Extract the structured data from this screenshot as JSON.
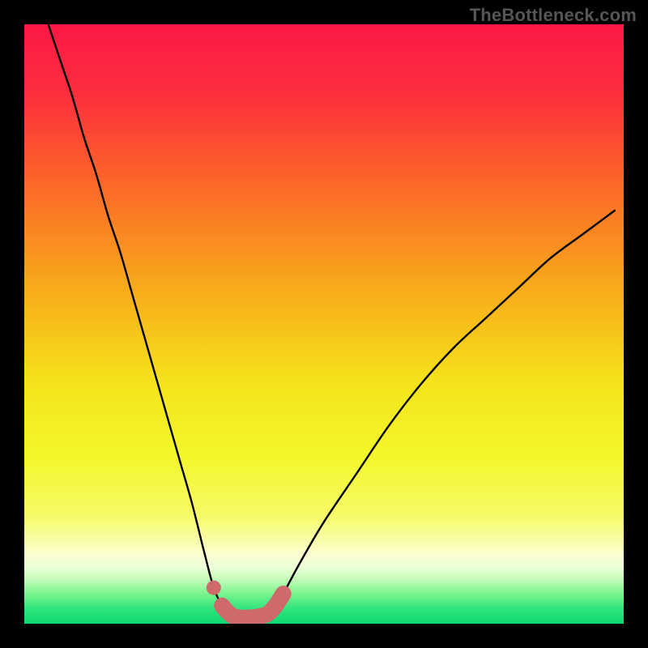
{
  "watermark": "TheBottleneck.com",
  "chart_data": {
    "type": "line",
    "title": "",
    "xlabel": "",
    "ylabel": "",
    "xlim": [
      0,
      100
    ],
    "ylim": [
      0,
      100
    ],
    "grid": false,
    "legend_position": "none",
    "series": [
      {
        "name": "bottleneck-curve",
        "x": [
          4,
          6,
          8,
          10,
          12,
          14,
          16,
          18,
          20,
          22,
          24,
          26,
          28,
          30,
          31.6,
          33,
          34.3,
          35.6,
          36.2,
          37.0,
          38.5,
          40.5,
          41.9,
          43.2,
          45.9,
          50.0,
          55.4,
          60.8,
          66.2,
          71.6,
          77.0,
          82.4,
          87.8,
          93.2,
          98.6
        ],
        "y": [
          100,
          94,
          88,
          81,
          75,
          68,
          62,
          55,
          48,
          41,
          34,
          27,
          20,
          12,
          6,
          3,
          1.6,
          1.0,
          1.0,
          1.0,
          1.1,
          1.6,
          3.0,
          5.0,
          10,
          17,
          25,
          33,
          40,
          46,
          51,
          56,
          61,
          65,
          69
        ]
      },
      {
        "name": "highlight-dot",
        "x": [
          31.6
        ],
        "y": [
          6.0
        ]
      },
      {
        "name": "highlight-band",
        "x": [
          33.0,
          34.3,
          35.6,
          36.2,
          37.0,
          38.5,
          40.5,
          41.9,
          43.2
        ],
        "y": [
          3.0,
          1.6,
          1.0,
          1.0,
          1.0,
          1.1,
          1.6,
          3.0,
          5.0
        ]
      }
    ],
    "background_gradient": {
      "stops": [
        {
          "offset": 0.0,
          "color": "#fd1846"
        },
        {
          "offset": 0.12,
          "color": "#fd2f3d"
        },
        {
          "offset": 0.28,
          "color": "#fb6d27"
        },
        {
          "offset": 0.45,
          "color": "#f8ae1a"
        },
        {
          "offset": 0.6,
          "color": "#f5e41b"
        },
        {
          "offset": 0.72,
          "color": "#f3f72a"
        },
        {
          "offset": 0.82,
          "color": "#f6fb68"
        },
        {
          "offset": 0.885,
          "color": "#fbfed1"
        },
        {
          "offset": 0.905,
          "color": "#eeffd9"
        },
        {
          "offset": 0.925,
          "color": "#c7fdbb"
        },
        {
          "offset": 0.95,
          "color": "#7af48e"
        },
        {
          "offset": 0.975,
          "color": "#30e47d"
        },
        {
          "offset": 1.0,
          "color": "#0fd770"
        }
      ]
    },
    "highlight_color": "#cf6a6c",
    "curve_color": "#000000"
  }
}
